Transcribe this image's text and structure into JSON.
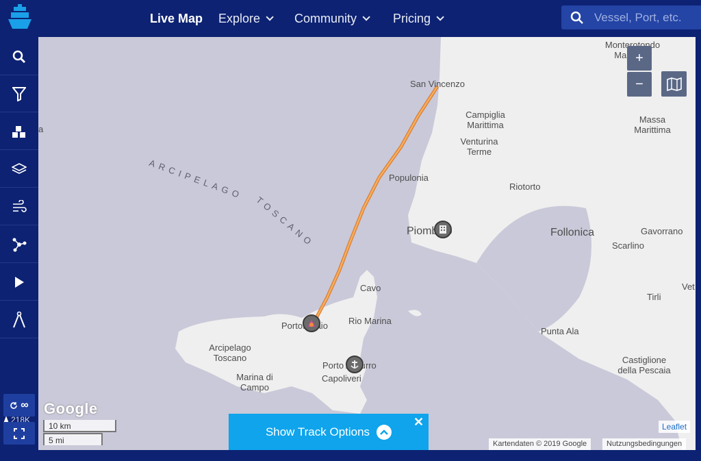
{
  "nav": {
    "live_map": "Live Map",
    "explore": "Explore",
    "community": "Community",
    "pricing": "Pricing"
  },
  "search": {
    "placeholder": "Vessel, Port, etc."
  },
  "sidebar": {
    "buttons": [
      {
        "icon": "search-icon"
      },
      {
        "icon": "filter-icon"
      },
      {
        "icon": "fleet-icon"
      },
      {
        "icon": "layers-icon"
      },
      {
        "icon": "wind-icon"
      },
      {
        "icon": "network-icon"
      },
      {
        "icon": "play-icon"
      },
      {
        "icon": "compass-measure-icon"
      }
    ],
    "vessel_count": "218K",
    "infinity_label": "∞"
  },
  "map": {
    "labels": {
      "monterotondo": "Monterotondo Marittimo",
      "san_vincenzo": "San Vincenzo",
      "campiglia": "Campiglia Marittima",
      "massa": "Massa Marittima",
      "venturina": "Venturina Terme",
      "populonia": "Populonia",
      "riotorto": "Riotorto",
      "piombino": "Piombino",
      "follonica": "Follonica",
      "gavorrano": "Gavorrano",
      "scarlino": "Scarlino",
      "cavo": "Cavo",
      "tirli": "Tirli",
      "vet": "Vet",
      "portoferraio": "Portoferraio",
      "rio_marina": "Rio Marina",
      "punta_ala": "Punta Ala",
      "arcipelago_toscano_island": "Arcipelago Toscano",
      "porto_azzurro": "Porto Azzurro",
      "castiglione": "Castiglione della Pescaia",
      "capoliveri": "Capoliveri",
      "marina_di_campo": "Marina di Campo",
      "left_edge": "a",
      "arch_line1": "ARCIPELAGO",
      "arch_line2": "TOSCANO"
    },
    "zoom_in": "+",
    "zoom_out": "−",
    "google_logo": "Google",
    "scale_km": "10 km",
    "scale_mi": "5 mi",
    "attribution": "Kartendaten © 2019 Google",
    "terms": "Nutzungsbedingungen",
    "leaflet": "Leaflet",
    "colors": {
      "sea": "#c9c9d9",
      "land": "#efefef",
      "track": "#f0a34a"
    }
  },
  "track_options": {
    "label": "Show Track Options",
    "close": "✕"
  }
}
